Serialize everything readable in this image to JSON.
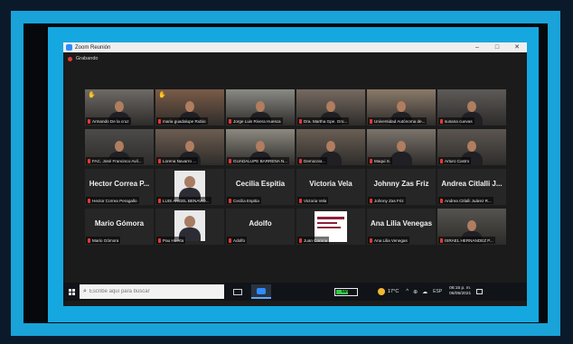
{
  "window": {
    "title": "Zoom Reunión",
    "controls": [
      "–",
      "□",
      "✕"
    ]
  },
  "recording": {
    "label": "Grabando"
  },
  "participants": [
    {
      "name": "Armando De la cruz",
      "kind": "video",
      "hand": true
    },
    {
      "name": "maria guadalupe Rubio",
      "kind": "video",
      "hand": true
    },
    {
      "name": "Jorge Luis Rivera Huesca",
      "kind": "video"
    },
    {
      "name": "Dra. Martha Gpe. Gro...",
      "kind": "video"
    },
    {
      "name": "Universidad Autónoma de...",
      "kind": "video"
    },
    {
      "name": "susana cuevas",
      "kind": "video"
    },
    {
      "name": "FAC. José Francisco Avil...",
      "kind": "video"
    },
    {
      "name": "Lorena Navarro ...",
      "kind": "video"
    },
    {
      "name": "GUADALUPE BARRENA N...",
      "kind": "video",
      "speaking": true
    },
    {
      "name": "Democrat...",
      "kind": "video"
    },
    {
      "name": "Maqui S.",
      "kind": "video"
    },
    {
      "name": "Arturo Castro",
      "kind": "video"
    },
    {
      "name": "Hector Correa Peragallo",
      "kind": "name",
      "display": "Hector Correa P..."
    },
    {
      "name": "LUIS ANGEL BENAVID...",
      "kind": "photo"
    },
    {
      "name": "Cecilia Espitia",
      "kind": "name",
      "display": "Cecilia Espitia"
    },
    {
      "name": "Victoria Vela",
      "kind": "name",
      "display": "Victoria Vela"
    },
    {
      "name": "Johnny Zas Friz",
      "kind": "name",
      "display": "Johnny Zas Friz"
    },
    {
      "name": "Andrea Citlalli Juárez R...",
      "kind": "name",
      "display": "Andrea Citlalli J..."
    },
    {
      "name": "Mario Gómora",
      "kind": "name",
      "display": "Mario Gómora"
    },
    {
      "name": "Pau Huerta",
      "kind": "photo"
    },
    {
      "name": "Adolfo",
      "kind": "name",
      "display": "Adolfo"
    },
    {
      "name": "Juan Corona",
      "kind": "doc",
      "doc_text": [
        "PROCURADURÍA",
        "DE LOS",
        "DERECHOS"
      ]
    },
    {
      "name": "Ana Lilia Venegas",
      "kind": "name",
      "display": "Ana Lilia Venegas"
    },
    {
      "name": "ISRAEL HERNANDEZ P...",
      "kind": "video"
    }
  ],
  "taskbar": {
    "search_placeholder": "Escribe aquí para buscar",
    "battery_label": "60%",
    "battery_level": 0.6,
    "temperature": "17°C",
    "tray_icons": [
      "^",
      "⊕",
      "☁"
    ],
    "language": "ESP",
    "time": "06:15 p. m.",
    "date": "06/05/2021"
  }
}
